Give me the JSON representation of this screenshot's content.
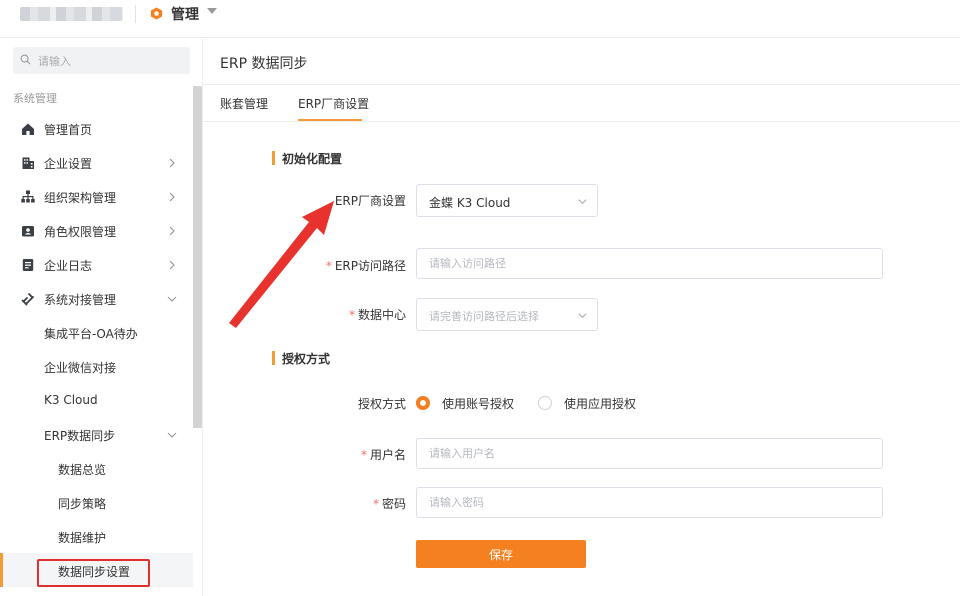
{
  "topbar": {
    "app_title": "管理"
  },
  "sidebar": {
    "search_placeholder": "请输入",
    "section_title": "系统管理",
    "items": [
      {
        "label": "管理首页",
        "icon": "home-icon"
      },
      {
        "label": "企业设置",
        "icon": "building-icon"
      },
      {
        "label": "组织架构管理",
        "icon": "org-chart-icon"
      },
      {
        "label": "角色权限管理",
        "icon": "id-card-icon"
      },
      {
        "label": "企业日志",
        "icon": "log-icon"
      },
      {
        "label": "系统对接管理",
        "icon": "link-icon"
      }
    ],
    "sub_items": [
      {
        "label": "集成平台-OA待办"
      },
      {
        "label": "企业微信对接"
      },
      {
        "label": "K3 Cloud"
      },
      {
        "label": "ERP数据同步"
      }
    ],
    "erp_children": [
      {
        "label": "数据总览"
      },
      {
        "label": "同步策略"
      },
      {
        "label": "数据维护"
      },
      {
        "label": "数据同步设置"
      }
    ]
  },
  "main": {
    "page_title": "ERP 数据同步",
    "tabs": [
      {
        "label": "账套管理"
      },
      {
        "label": "ERP厂商设置"
      }
    ],
    "init_section": "初始化配置",
    "auth_section": "授权方式",
    "form": {
      "vendor": {
        "label": "ERP厂商设置",
        "value": "金蝶 K3 Cloud"
      },
      "path": {
        "label": "ERP访问路径",
        "placeholder": "请输入访问路径",
        "required_mark": "*"
      },
      "datacenter": {
        "label": "数据中心",
        "placeholder": "请完善访问路径后选择",
        "required_mark": "*"
      },
      "auth_mode": {
        "label": "授权方式",
        "option_account": "使用账号授权",
        "option_app": "使用应用授权"
      },
      "username": {
        "label": "用户名",
        "placeholder": "请输入用户名",
        "required_mark": "*"
      },
      "password": {
        "label": "密码",
        "placeholder": "请输入密码",
        "required_mark": "*"
      }
    },
    "save_label": "保存"
  },
  "colors": {
    "accent": "#f5801f",
    "annotation": "#e8322e",
    "required": "#f56c6c"
  }
}
